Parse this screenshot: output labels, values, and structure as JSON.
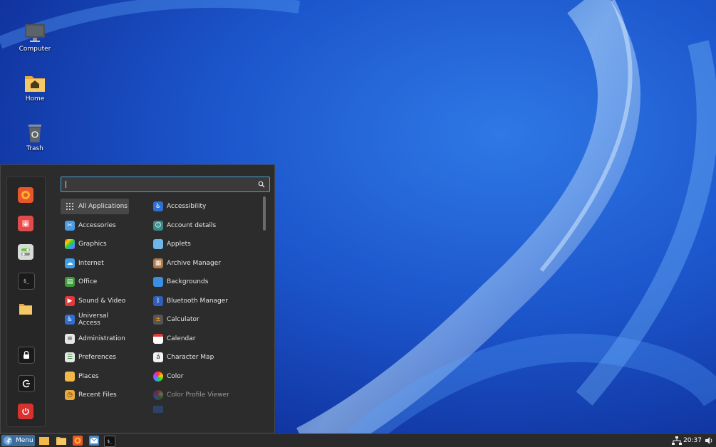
{
  "desktop": {
    "icons": [
      {
        "label": "Computer"
      },
      {
        "label": "Home"
      },
      {
        "label": "Trash"
      }
    ]
  },
  "menu": {
    "search": {
      "value": ""
    },
    "categories": [
      {
        "label": "All Applications"
      },
      {
        "label": "Accessories"
      },
      {
        "label": "Graphics"
      },
      {
        "label": "Internet"
      },
      {
        "label": "Office"
      },
      {
        "label": "Sound & Video"
      },
      {
        "label": "Universal Access"
      },
      {
        "label": "Administration"
      },
      {
        "label": "Preferences"
      },
      {
        "label": "Places"
      },
      {
        "label": "Recent Files"
      }
    ],
    "apps": [
      {
        "label": "Accessibility"
      },
      {
        "label": "Account details"
      },
      {
        "label": "Applets"
      },
      {
        "label": "Archive Manager"
      },
      {
        "label": "Backgrounds"
      },
      {
        "label": "Bluetooth Manager"
      },
      {
        "label": "Calculator"
      },
      {
        "label": "Calendar"
      },
      {
        "label": "Character Map"
      },
      {
        "label": "Color"
      },
      {
        "label": "Color Profile Viewer"
      }
    ]
  },
  "taskbar": {
    "menu_label": "Menu",
    "clock": "20:37"
  },
  "colors": {
    "accent": "#4aa3d9",
    "menu_bg": "#2c2c2c",
    "wallpaper": "#1b4fc4"
  }
}
